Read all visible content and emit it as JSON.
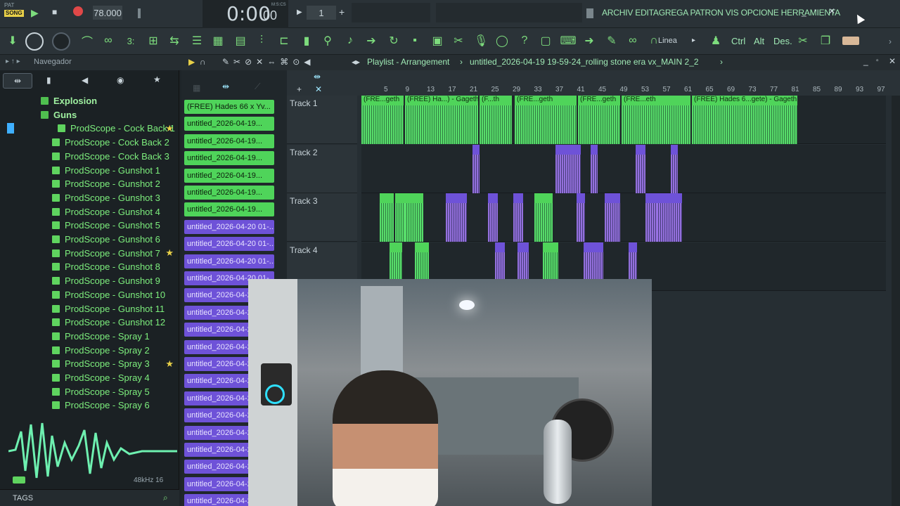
{
  "window": {
    "menu": "ARCHIV EDITAGREGA PATRON VIS OPCIONE HERRAMIENTA",
    "tempo": "78.000",
    "time": "0:00",
    "time_sub": "00",
    "time_unit": "M:S:CS",
    "pattern_num": "1",
    "mode_top": "PAT",
    "mode_bottom": "SONG"
  },
  "toolbar": {
    "snap_label": "Linea",
    "ctrl_label": "Ctrl",
    "alt_label": "Alt",
    "des_label": "Des."
  },
  "browser": {
    "title": "Navegador",
    "items": [
      {
        "label": "Explosion",
        "folder": true,
        "star": false
      },
      {
        "label": "Guns",
        "folder": true,
        "star": false
      },
      {
        "label": "ProdScope - Cock Back 1",
        "star": true
      },
      {
        "label": "ProdScope - Cock Back 2",
        "star": false
      },
      {
        "label": "ProdScope - Cock Back 3",
        "star": false
      },
      {
        "label": "ProdScope - Gunshot 1",
        "star": false
      },
      {
        "label": "ProdScope - Gunshot 2",
        "star": false
      },
      {
        "label": "ProdScope - Gunshot 3",
        "star": false
      },
      {
        "label": "ProdScope - Gunshot 4",
        "star": false
      },
      {
        "label": "ProdScope - Gunshot 5",
        "star": false
      },
      {
        "label": "ProdScope - Gunshot 6",
        "star": false
      },
      {
        "label": "ProdScope - Gunshot 7",
        "star": true
      },
      {
        "label": "ProdScope - Gunshot 8",
        "star": false
      },
      {
        "label": "ProdScope - Gunshot 9",
        "star": false
      },
      {
        "label": "ProdScope - Gunshot 10",
        "star": false
      },
      {
        "label": "ProdScope - Gunshot 11",
        "star": false
      },
      {
        "label": "ProdScope - Gunshot 12",
        "star": false
      },
      {
        "label": "ProdScope - Spray 1",
        "star": false
      },
      {
        "label": "ProdScope - Spray 2",
        "star": false
      },
      {
        "label": "ProdScope - Spray 3",
        "star": true
      },
      {
        "label": "ProdScope - Spray 4",
        "star": false
      },
      {
        "label": "ProdScope - Spray 5",
        "star": false
      },
      {
        "label": "ProdScope - Spray 6",
        "star": false
      }
    ],
    "sample_info": "48kHz 16",
    "tags_label": "TAGS"
  },
  "picker": {
    "clips": [
      {
        "label": "(FREE) Hades 66 x Yv...",
        "color": "green"
      },
      {
        "label": "untitled_2026-04-19...",
        "color": "green"
      },
      {
        "label": "untitled_2026-04-19...",
        "color": "green"
      },
      {
        "label": "untitled_2026-04-19...",
        "color": "green"
      },
      {
        "label": "untitled_2026-04-19...",
        "color": "green"
      },
      {
        "label": "untitled_2026-04-19...",
        "color": "green"
      },
      {
        "label": "untitled_2026-04-19...",
        "color": "green"
      },
      {
        "label": "untitled_2026-04-20 01-...",
        "color": "purple"
      },
      {
        "label": "untitled_2026-04-20 01-...",
        "color": "purple"
      },
      {
        "label": "untitled_2026-04-20 01-...",
        "color": "purple"
      },
      {
        "label": "untitled_2026-04-20 01-...",
        "color": "purple"
      },
      {
        "label": "untitled_2026-04-2",
        "color": "purple"
      },
      {
        "label": "untitled_2026-04-2",
        "color": "purple"
      },
      {
        "label": "untitled_2026-04-2",
        "color": "purple"
      },
      {
        "label": "untitled_2026-04-2",
        "color": "purple"
      },
      {
        "label": "untitled_2026-04-2",
        "color": "purple"
      },
      {
        "label": "untitled_2026-04-2",
        "color": "purple"
      },
      {
        "label": "untitled_2026-04-2",
        "color": "purple"
      },
      {
        "label": "untitled_2026-04-2",
        "color": "purple"
      },
      {
        "label": "untitled_2026-04-2",
        "color": "purple"
      },
      {
        "label": "untitled_2026-04-2",
        "color": "purple"
      },
      {
        "label": "untitled_2026-04-2",
        "color": "purple"
      },
      {
        "label": "untitled_2026-04-2",
        "color": "purple"
      },
      {
        "label": "untitled_2026-04-2",
        "color": "purple"
      }
    ]
  },
  "playlist": {
    "title": "Playlist - Arrangement",
    "project": "untitled_2026-04-19 19-59-24_rolling stone era vx_MAIN 2_2",
    "ruler": [
      "5",
      "9",
      "13",
      "17",
      "21",
      "25",
      "29",
      "33",
      "37",
      "41",
      "45",
      "49",
      "53",
      "57",
      "61",
      "65",
      "69",
      "73",
      "77",
      "81",
      "85",
      "89",
      "93",
      "97"
    ],
    "tracks": [
      "Track 1",
      "Track 2",
      "Track 3",
      "Track 4"
    ],
    "track1_segments": [
      "(FRE...geth",
      "(FREE) Ha...) - Gageth",
      "(F...th",
      "(FRE...geth",
      "(FRE...geth",
      "(FRE...eth",
      "(FREE) Hades 6...gete) - Gageth"
    ]
  },
  "colors": {
    "accent_green": "#5fd45f",
    "accent_purple": "#6e52d8"
  }
}
